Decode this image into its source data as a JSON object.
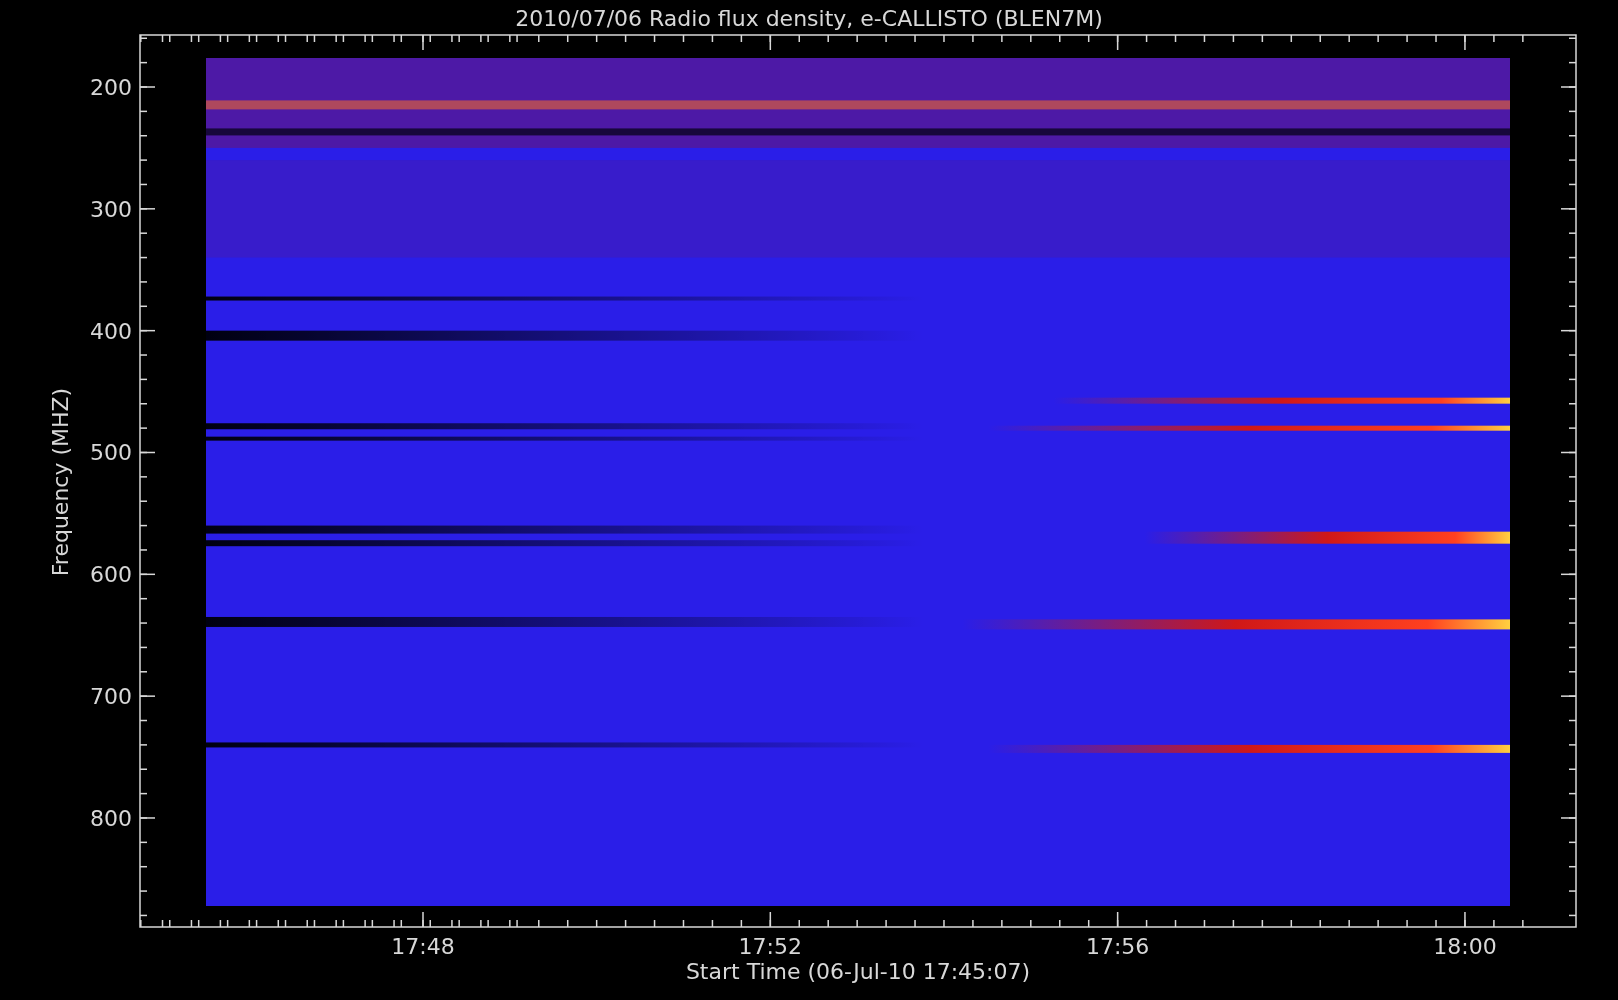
{
  "title": "2010/07/06  Radio flux density, e-CALLISTO (BLEN7M)",
  "y_axis": {
    "label": "Frequency (MHZ)",
    "ticks": [
      "200",
      "300",
      "400",
      "500",
      "600",
      "700",
      "800"
    ]
  },
  "x_axis": {
    "label": "Start Time (06-Jul-10 17:45:07)",
    "ticks": [
      "17:48",
      "17:52",
      "17:56",
      "18:00"
    ]
  }
}
